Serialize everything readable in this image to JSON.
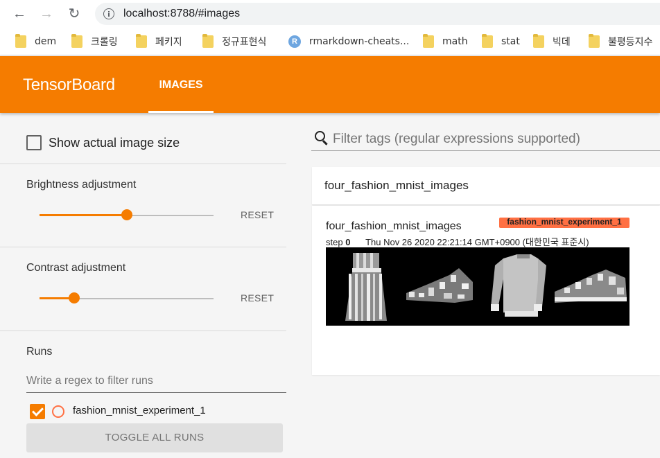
{
  "browser": {
    "url": "localhost:8788/#images",
    "bookmarks": [
      {
        "label": "dem",
        "icon": "folder-icon"
      },
      {
        "label": "크롤링",
        "icon": "folder-icon"
      },
      {
        "label": "페키지",
        "icon": "folder-icon"
      },
      {
        "label": "정규표현식",
        "icon": "folder-icon"
      },
      {
        "label": "rmarkdown-cheats...",
        "icon": "r-icon",
        "icon_text": "R"
      },
      {
        "label": "math",
        "icon": "folder-icon"
      },
      {
        "label": "stat",
        "icon": "folder-icon"
      },
      {
        "label": "빅데",
        "icon": "folder-icon"
      },
      {
        "label": "불평등지수",
        "icon": "folder-icon"
      }
    ]
  },
  "header": {
    "title": "TensorBoard",
    "active_tab": "IMAGES",
    "color": "#f57c00"
  },
  "sidebar": {
    "show_actual_size_label": "Show actual image size",
    "brightness": {
      "title": "Brightness adjustment",
      "value": 0.5,
      "reset": "RESET"
    },
    "contrast": {
      "title": "Contrast adjustment",
      "value": 0.2,
      "reset": "RESET"
    },
    "runs": {
      "title": "Runs",
      "filter_placeholder": "Write a regex to filter runs",
      "items": [
        {
          "name": "fashion_mnist_experiment_1",
          "checked": true,
          "color": "#ff7043"
        }
      ],
      "toggle_label": "TOGGLE ALL RUNS"
    }
  },
  "main": {
    "filter_placeholder": "Filter tags (regular expressions supported)",
    "tag_group": "four_fashion_mnist_images",
    "card": {
      "tag": "four_fashion_mnist_images",
      "run": "fashion_mnist_experiment_1",
      "step_label": "step",
      "step": "0",
      "timestamp": "Thu Nov 26 2020 22:21:14 GMT+0900 (대한민국 표준시)"
    }
  }
}
